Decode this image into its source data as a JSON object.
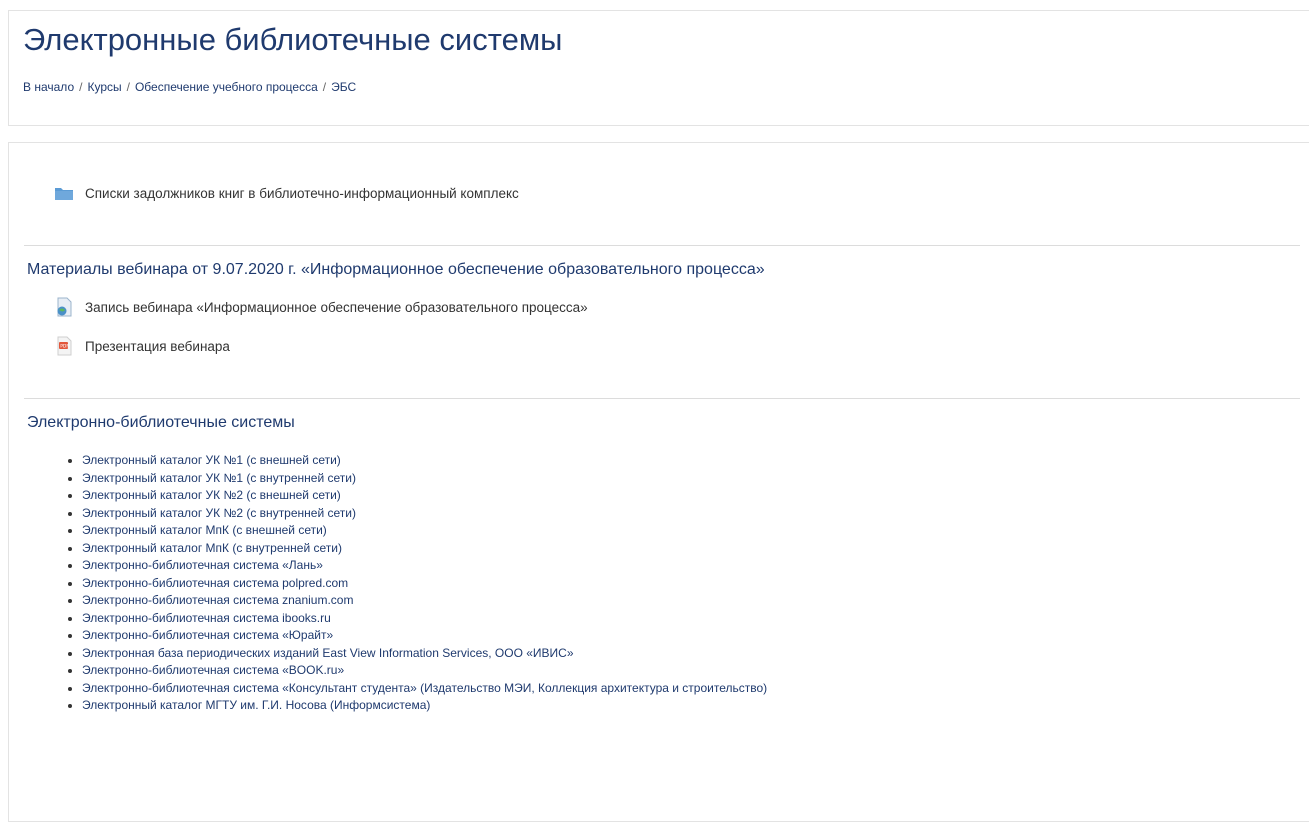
{
  "header": {
    "title": "Электронные библиотечные системы",
    "breadcrumb": [
      "В начало",
      "Курсы",
      "Обеспечение учебного процесса",
      "ЭБС"
    ],
    "separator": "/"
  },
  "activities_top": [
    {
      "label": "Списки задолжников книг в библиотечно-информационный комплекс",
      "icon": "folder-icon"
    }
  ],
  "sections": [
    {
      "title": "Материалы вебинара от 9.07.2020 г. «Информационное обеспечение образовательного процесса»",
      "activities": [
        {
          "label": "Запись вебинара «Информационное обеспечение образовательного процесса»",
          "icon": "url-globe-icon"
        },
        {
          "label": "Презентация вебинара",
          "icon": "pdf-icon"
        }
      ]
    },
    {
      "title": "Электронно-библиотечные системы",
      "links": [
        "Электронный каталог УК №1 (с внешней сети)",
        "Электронный каталог УК №1 (с внутренней сети)",
        "Электронный каталог УК №2 (с внешней сети)",
        "Электронный каталог УК №2 (с внутренней сети)",
        "Электронный каталог МпК (с внешней сети)",
        "Электронный каталог МпК (с внутренней сети)",
        "Электронно-библиотечная система «Лань»",
        "Электронно-библиотечная система polpred.com",
        "Электронно-библиотечная система znanium.com",
        "Электронно-библиотечная система ibooks.ru",
        "Электронно-библиотечная система «Юрайт»",
        "Электронная база периодических изданий East View Information Services, ООО «ИВИС»",
        "Электронно-библиотечная система «BOOK.ru»",
        "Электронно-библиотечная система «Консультант студента» (Издательство МЭИ, Коллекция архитектура и строительство)",
        "Электронный каталог МГТУ им. Г.И. Носова (Информсистема)"
      ]
    }
  ],
  "colors": {
    "title": "#1f3a6e",
    "link": "#1f3a6e",
    "text": "#333333",
    "folder": "#5b9bd5"
  }
}
